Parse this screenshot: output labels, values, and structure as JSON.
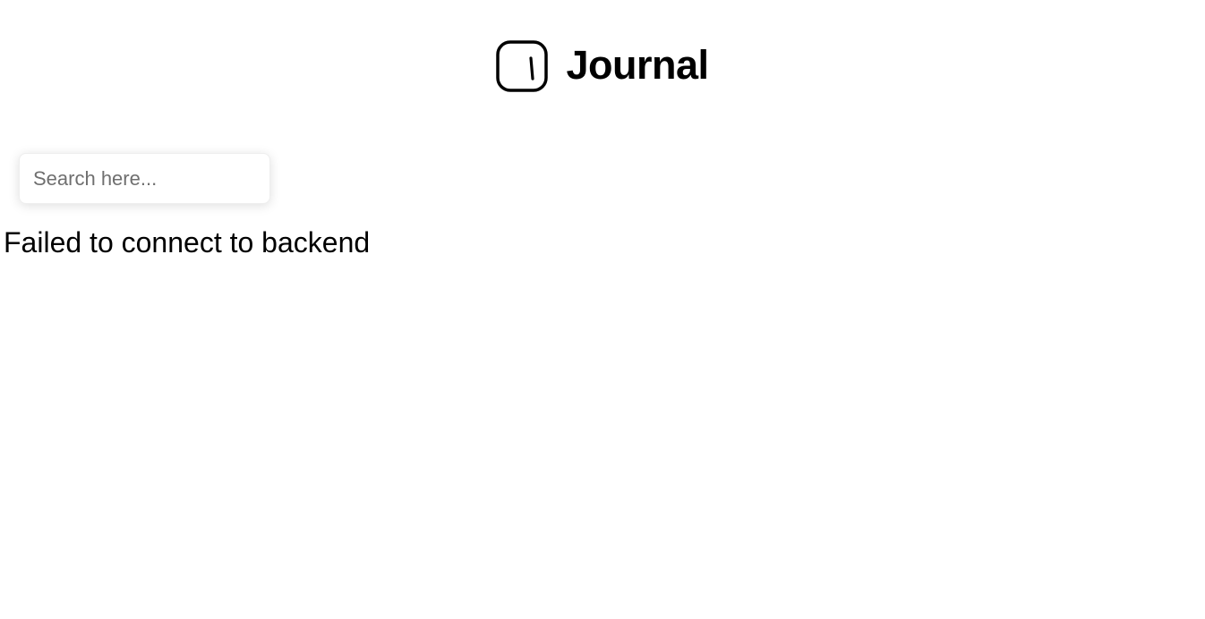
{
  "header": {
    "logo_icon": "journal-square-icon",
    "title": "Journal"
  },
  "search": {
    "value": "",
    "placeholder": "Search here..."
  },
  "status": {
    "error_message": "Failed to connect to backend"
  },
  "colors": {
    "background": "#ffffff",
    "text": "#000000",
    "placeholder": "#6f6f6f"
  }
}
